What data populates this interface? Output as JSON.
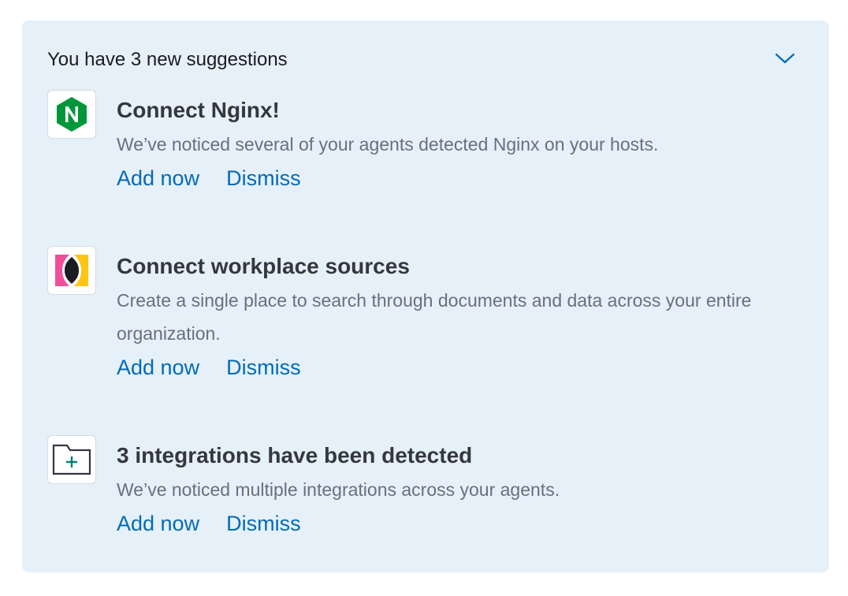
{
  "header": {
    "title": "You have 3 new suggestions",
    "collapse_icon": "chevron-down-icon"
  },
  "colors": {
    "panel_bg": "#e6f0f8",
    "link": "#006bb8",
    "title": "#343741",
    "description": "#69707d",
    "nginx_green": "#009639",
    "workplace_pink": "#f04e98",
    "workplace_yellow": "#fec514",
    "integration_plus": "#017d73"
  },
  "suggestions": [
    {
      "icon": "nginx-logo-icon",
      "title": "Connect Nginx!",
      "description": "We’ve noticed several of your agents detected Nginx on your hosts.",
      "add_label": "Add now",
      "dismiss_label": "Dismiss"
    },
    {
      "icon": "workplace-search-logo-icon",
      "title": "Connect workplace sources",
      "description": "Create a single place to search through documents and data across your entire organization.",
      "add_label": "Add now",
      "dismiss_label": "Dismiss"
    },
    {
      "icon": "folder-add-icon",
      "title": "3 integrations have been detected",
      "description": "We’ve noticed multiple integrations across your agents.",
      "add_label": "Add now",
      "dismiss_label": "Dismiss"
    }
  ]
}
